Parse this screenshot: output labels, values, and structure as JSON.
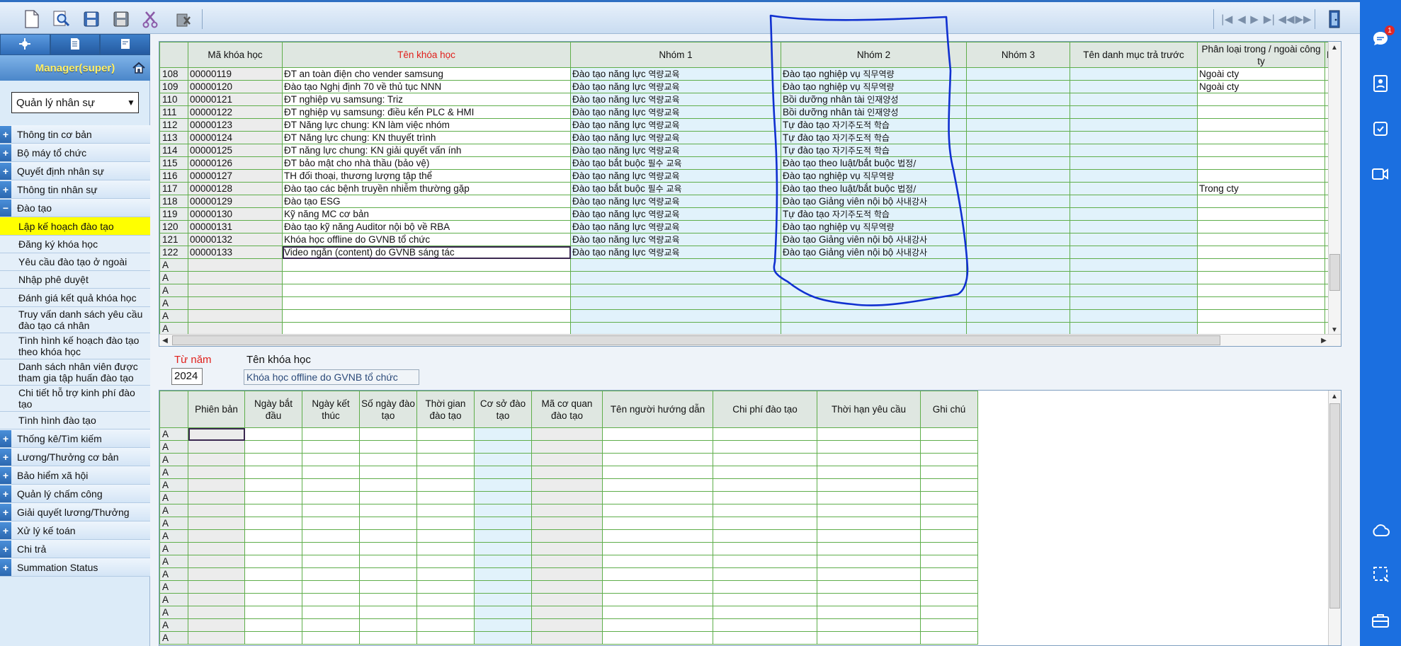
{
  "toolbar": {
    "buttons": [
      "new-document-icon",
      "search-icon",
      "save-icon",
      "save-as-icon",
      "cut-icon",
      "delete-icon"
    ],
    "nav": {
      "first": "|◀",
      "prev": "◀",
      "next": "▶",
      "last": "▶|",
      "rewind": "◀◀",
      "forward": "▶▶"
    }
  },
  "sidebar": {
    "user": "Manager(super)",
    "module": "Quản lý nhân sự",
    "menu": [
      {
        "label": "Thông tin cơ bản",
        "sign": "+"
      },
      {
        "label": "Bộ máy tổ chức",
        "sign": "+"
      },
      {
        "label": "Quyết định nhân sự",
        "sign": "+"
      },
      {
        "label": "Thông tin nhân sự",
        "sign": "+"
      },
      {
        "label": "Đào tạo",
        "sign": "−"
      }
    ],
    "sub": [
      "Lập kế hoạch đào tạo",
      "Đăng ký khóa học",
      "Yêu cầu đào tạo ở ngoài",
      "Nhập phê duyệt",
      "Đánh giá kết quả khóa học",
      "Truy vấn danh sách yêu cầu đào tạo cá nhân",
      "Tình hình kế hoạch đào tạo theo khóa học",
      "Danh sách nhân viên được tham gia tập huấn đào tạo",
      "Chi tiết hỗ trợ kinh phí đào tạo",
      "Tình hình đào tạo"
    ],
    "menu2": [
      "Thống kê/Tìm kiếm",
      "Lương/Thưởng cơ bản",
      "Bảo hiểm xã hội",
      "Quản lý chấm công",
      "Giải quyết lương/Thưởng",
      "Xử lý kế toán",
      "Chi trả",
      "Summation Status"
    ]
  },
  "grid1": {
    "headers": [
      "Mã khóa học",
      "Tên khóa học",
      "Nhóm 1",
      "Nhóm 2",
      "Nhóm 3",
      "Tên danh mục trả trước",
      "Phân loại trong / ngoài công ty",
      "D"
    ],
    "rows": [
      {
        "no": "108",
        "code": "00000119",
        "name": "ĐT an toàn điện cho vender samsung",
        "g1": "Đào tạo năng lực",
        "g1k": "역량교육",
        "g2": "Đào tạo nghiệp vụ",
        "g2k": "직무역량",
        "io": "Ngoài cty"
      },
      {
        "no": "109",
        "code": "00000120",
        "name": "Đào tạo Nghị định 70 về thủ tục NNN",
        "g1": "Đào tạo năng lực",
        "g1k": "역량교육",
        "g2": "Đào tạo nghiệp vụ",
        "g2k": "직무역량",
        "io": "Ngoài cty"
      },
      {
        "no": "110",
        "code": "00000121",
        "name": "ĐT nghiệp vụ samsung: Triz",
        "g1": "Đào tạo năng lực",
        "g1k": "역량교육",
        "g2": "Bồi dưỡng nhân tài",
        "g2k": "인재양성",
        "io": ""
      },
      {
        "no": "111",
        "code": "00000122",
        "name": "ĐT nghiệp vụ samsung: điều kển PLC & HMI",
        "g1": "Đào tạo năng lực",
        "g1k": "역량교육",
        "g2": "Bồi dưỡng nhân tài",
        "g2k": "인재양성",
        "io": ""
      },
      {
        "no": "112",
        "code": "00000123",
        "name": "ĐT Năng lực chung: KN làm việc nhóm",
        "g1": "Đào tạo năng lực",
        "g1k": "역량교육",
        "g2": "Tự đào tạo",
        "g2k": "자기주도적 학습",
        "io": ""
      },
      {
        "no": "113",
        "code": "00000124",
        "name": "ĐT Năng lực chung: KN thuyết trình",
        "g1": "Đào tạo năng lực",
        "g1k": "역량교육",
        "g2": "Tự đào tạo",
        "g2k": "자기주도적 학습",
        "io": ""
      },
      {
        "no": "114",
        "code": "00000125",
        "name": "ĐT năng lực chung: KN giải quyết vấn ính",
        "g1": "Đào tạo năng lực",
        "g1k": "역량교육",
        "g2": "Tự đào tạo",
        "g2k": "자기주도적 학습",
        "io": ""
      },
      {
        "no": "115",
        "code": "00000126",
        "name": "ĐT bảo mật cho nhà thầu (bảo vệ)",
        "g1": "Đào tạo bắt buộc",
        "g1k": "필수 교육",
        "g2": "Đào tạo theo luật/bắt buộc",
        "g2k": "법정/",
        "io": ""
      },
      {
        "no": "116",
        "code": "00000127",
        "name": "TH đối thoại, thương lượng tập thể",
        "g1": "Đào tạo năng lực",
        "g1k": "역량교육",
        "g2": "Đào tạo nghiệp vụ",
        "g2k": "직무역량",
        "io": ""
      },
      {
        "no": "117",
        "code": "00000128",
        "name": "Đào tạo các bệnh truyền nhiễm thường gặp",
        "g1": "Đào tạo bắt buộc",
        "g1k": "필수 교육",
        "g2": "Đào tạo theo luật/bắt buộc",
        "g2k": "법정/",
        "io": "Trong cty"
      },
      {
        "no": "118",
        "code": "00000129",
        "name": "Đào tạo ESG",
        "g1": "Đào tạo năng lực",
        "g1k": "역량교육",
        "g2": "Đào tạo Giảng viên nội bộ",
        "g2k": "사내강사",
        "io": ""
      },
      {
        "no": "119",
        "code": "00000130",
        "name": "Kỹ năng MC cơ bản",
        "g1": "Đào tạo năng lực",
        "g1k": "역량교육",
        "g2": "Tự đào tạo",
        "g2k": "자기주도적 학습",
        "io": ""
      },
      {
        "no": "120",
        "code": "00000131",
        "name": "Đào tạo kỹ năng Auditor nội bộ về RBA",
        "g1": "Đào tạo năng lực",
        "g1k": "역량교육",
        "g2": "Đào tạo nghiệp vụ",
        "g2k": "직무역량",
        "io": ""
      },
      {
        "no": "121",
        "code": "00000132",
        "name": "Khóa học offline do GVNB tổ chức",
        "g1": "Đào tạo năng lực",
        "g1k": "역량교육",
        "g2": "Đào tạo Giảng viên nội bộ",
        "g2k": "사내강사",
        "io": ""
      },
      {
        "no": "122",
        "code": "00000133",
        "name": "Video ngắn (content) do GVNB sáng tác",
        "g1": "Đào tạo năng lực",
        "g1k": "역량교육",
        "g2": "Đào tạo Giảng viên nội bộ",
        "g2k": "사내강사",
        "io": ""
      }
    ],
    "empty_marker": "A"
  },
  "filter": {
    "year_label": "Từ năm",
    "year": "2024",
    "course_label": "Tên khóa học",
    "course": "Khóa học offline do GVNB tổ chức"
  },
  "grid2": {
    "headers": [
      "Phiên bản",
      "Ngày bắt đầu",
      "Ngày kết thúc",
      "Số ngày đào tạo",
      "Thời gian đào tạo",
      "Cơ sở đào tạo",
      "Mã cơ quan đào tạo",
      "Tên người hướng dẫn",
      "Chi phí đào tạo",
      "Thời hạn yêu cầu",
      "Ghi chú"
    ],
    "marker": "A"
  },
  "dock": {
    "icons": [
      "chat-icon",
      "contacts-icon",
      "task-check-icon",
      "video-call-icon",
      "cloud-icon",
      "screenshot-icon",
      "briefcase-icon"
    ],
    "badge": "1"
  },
  "colors": {
    "accent": "#1b6fe0",
    "grid_border": "#5fae4b",
    "required_header": "#e0201c",
    "active_menu": "#ffff00",
    "annotation": "#1030d0"
  }
}
